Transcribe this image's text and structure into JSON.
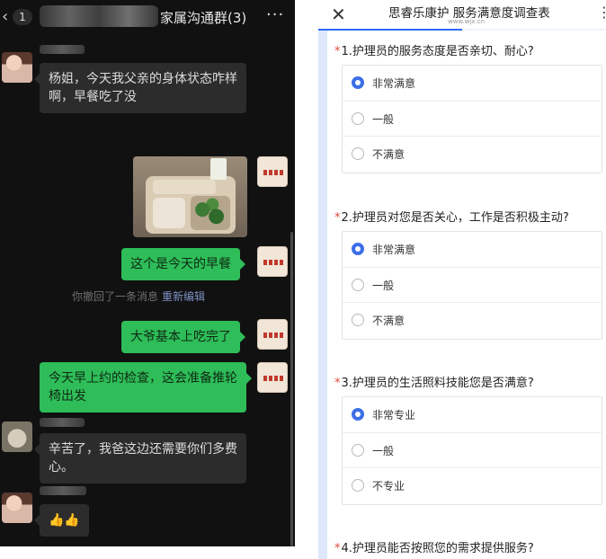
{
  "chat": {
    "header": {
      "unread": "1",
      "title": "家属沟通群(3)",
      "more": "···"
    },
    "messages": [
      {
        "text": "杨姐，今天我父亲的身体状态咋样啊，早餐吃了没"
      },
      {
        "text": "这个是今天的早餐"
      },
      {
        "text": "大爷基本上吃完了"
      },
      {
        "text": "今天早上约的检查，这会准备推轮椅出发"
      },
      {
        "text": "辛苦了，我爸这边还需要你们多费心。"
      },
      {
        "text": "👍👍"
      }
    ],
    "recall": {
      "text": "你撤回了一条消息",
      "edit": "重新编辑"
    }
  },
  "survey": {
    "title": "思睿乐康护 服务满意度调查表",
    "site": "www.wjx.cn",
    "progress": 0.5,
    "accent_color": "#3c6ee8",
    "questions": [
      {
        "star": "*",
        "title": "1.护理员的服务态度是否亲切、耐心?",
        "options": [
          "非常满意",
          "一般",
          "不满意"
        ],
        "selected": 0
      },
      {
        "star": "*",
        "title": "2.护理员对您是否关心，工作是否积极主动?",
        "options": [
          "非常满意",
          "一般",
          "不满意"
        ],
        "selected": 0
      },
      {
        "star": "*",
        "title": "3.护理员的生活照料技能您是否满意?",
        "options": [
          "非常专业",
          "一般",
          "不专业"
        ],
        "selected": 0
      },
      {
        "star": "*",
        "title": "4.护理员能否按照您的需求提供服务?"
      }
    ]
  }
}
